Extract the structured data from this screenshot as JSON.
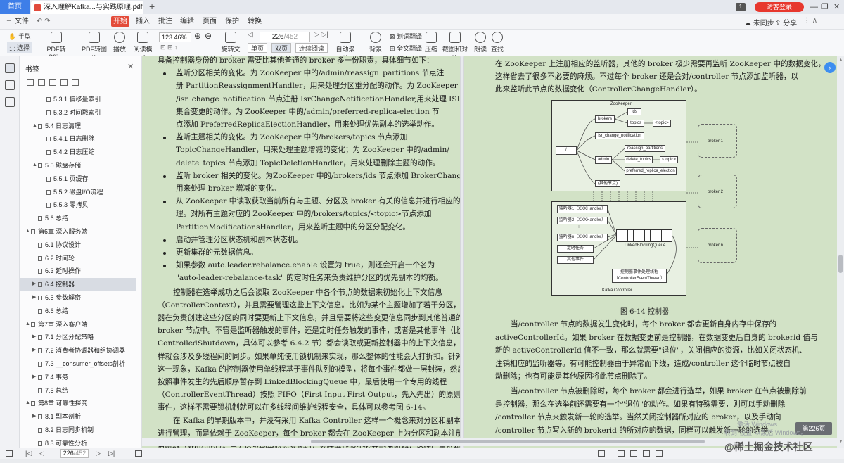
{
  "window": {
    "home_tab": "首页",
    "doc_tab": "深入理解Kafka...与实践原理.pdf",
    "new_tab": "+",
    "login": "访客登录",
    "page_badge": "1"
  },
  "menu": {
    "file": "三 文件",
    "start": "开始",
    "items": [
      "插入",
      "批注",
      "编辑",
      "页面",
      "保护",
      "转换"
    ],
    "cloud": "未同步",
    "share": "分享"
  },
  "toolbar": {
    "hand": "手型",
    "select": "选择",
    "pdf_to_office": "PDF转Office",
    "pdf_to_image": "PDF转图片",
    "play": "播放",
    "read_mode": "阅读模式",
    "zoom": "123.46%",
    "rotate": "旋转文档",
    "page_current": "226",
    "page_total": "/452",
    "single": "单页",
    "double": "双页",
    "continuous": "连续阅读",
    "autoscroll": "自动滚动",
    "background": "背景",
    "word_translate": "划词翻译",
    "full_translate": "全文翻译",
    "compress": "压缩",
    "screenshot": "截图和对比",
    "read_aloud": "朗读",
    "find": "查找"
  },
  "bookmarks": {
    "title": "书签",
    "close": "✕",
    "items": [
      {
        "level": 3,
        "label": "5.3.1 偏移量索引",
        "arrow": ""
      },
      {
        "level": 3,
        "label": "5.3.2 时间戳索引",
        "arrow": ""
      },
      {
        "level": 2,
        "label": "5.4 日志清理",
        "arrow": "▲"
      },
      {
        "level": 3,
        "label": "5.4.1 日志删除",
        "arrow": ""
      },
      {
        "level": 3,
        "label": "5.4.2 日志压缩",
        "arrow": ""
      },
      {
        "level": 2,
        "label": "5.5 磁盘存储",
        "arrow": "▲"
      },
      {
        "level": 3,
        "label": "5.5.1 页缓存",
        "arrow": ""
      },
      {
        "level": 3,
        "label": "5.5.2 磁盘I/O流程",
        "arrow": ""
      },
      {
        "level": 3,
        "label": "5.5.3 零拷贝",
        "arrow": ""
      },
      {
        "level": 2,
        "label": "5.6 总结",
        "arrow": ""
      },
      {
        "level": 1,
        "label": "第6章 深入服务端",
        "arrow": "▲"
      },
      {
        "level": 2,
        "label": "6.1 协议设计",
        "arrow": ""
      },
      {
        "level": 2,
        "label": "6.2 时间轮",
        "arrow": ""
      },
      {
        "level": 2,
        "label": "6.3 延时操作",
        "arrow": ""
      },
      {
        "level": 2,
        "label": "6.4 控制器",
        "arrow": "▶",
        "selected": true
      },
      {
        "level": 2,
        "label": "6.5 参数解密",
        "arrow": "▶"
      },
      {
        "level": 2,
        "label": "6.6 总结",
        "arrow": ""
      },
      {
        "level": 1,
        "label": "第7章 深入客户端",
        "arrow": "▲"
      },
      {
        "level": 2,
        "label": "7.1 分区分配策略",
        "arrow": "▶"
      },
      {
        "level": 2,
        "label": "7.2 消费者协调器和组协调器",
        "arrow": "▶"
      },
      {
        "level": 2,
        "label": "7.3 __consumer_offsets剖析",
        "arrow": ""
      },
      {
        "level": 2,
        "label": "7.4 事务",
        "arrow": "▶"
      },
      {
        "level": 2,
        "label": "7.5 总结",
        "arrow": ""
      },
      {
        "level": 1,
        "label": "第8章 可靠性探究",
        "arrow": "▲"
      },
      {
        "level": 2,
        "label": "8.1 副本剖析",
        "arrow": "▶"
      },
      {
        "level": 2,
        "label": "8.2 日志同步机制",
        "arrow": ""
      },
      {
        "level": 2,
        "label": "8.3 可靠性分析",
        "arrow": ""
      },
      {
        "level": 2,
        "label": "8.4 总结",
        "arrow": ""
      }
    ]
  },
  "left_page": {
    "lines": [
      {
        "t": "具备控制器身份的 broker 需要比其他普通的 broker 多一份职责，具体细节如下：",
        "i": 0
      },
      {
        "t": "监听分区相关的变化。为 ZooKeeper 中的/admin/reassign_partitions 节点注",
        "i": 1,
        "b": true
      },
      {
        "t": "册 PartitionReassignmentHandler，用来处理分区重分配的动作。为 ZooKeeper 中的",
        "i": 2
      },
      {
        "t": "/isr_change_notification 节点注册 IsrChangeNotificetionHandler,用来处理 ISR",
        "i": 2
      },
      {
        "t": "集合变更的动作。为 ZooKeeper 中的/admin/preferred-replica-election 节",
        "i": 2
      },
      {
        "t": "点添加 PreferredReplicaElectionHandler，用来处理优先副本的选举动作。",
        "i": 2
      },
      {
        "t": "监听主题相关的变化。为 ZooKeeper 中的/brokers/topics 节点添加",
        "i": 1,
        "b": true
      },
      {
        "t": "TopicChangeHandler，用来处理主题增减的变化；为 ZooKeeper 中的/admin/",
        "i": 2
      },
      {
        "t": "delete_topics 节点添加 TopicDeletionHandler，用来处理删除主题的动作。",
        "i": 2
      },
      {
        "t": "监听 broker 相关的变化。为ZooKeeper 中的/brokers/ids 节点添加 BrokerChangeHandler,",
        "i": 1,
        "b": true
      },
      {
        "t": "用来处理 broker 增减的变化。",
        "i": 2
      },
      {
        "t": "从 ZooKeeper 中读取获取当前所有与主题、分区及 broker 有关的信息并进行相应的管",
        "i": 1,
        "b": true
      },
      {
        "t": "理。对所有主题对应的 ZooKeeper 中的/brokers/topics/<topic>节点添加",
        "i": 2
      },
      {
        "t": "PartitionModificationsHandler，用来监听主题中的分区分配变化。",
        "i": 2
      },
      {
        "t": "启动并管理分区状态机和副本状态机。",
        "i": 1,
        "b": true
      },
      {
        "t": "更新集群的元数据信息。",
        "i": 1,
        "b": true
      },
      {
        "t": "如果参数 auto.leader.rebalance.enable 设置为 true，则还会开启一个名为",
        "i": 1,
        "b": true
      },
      {
        "t": "\"auto-leader-rebalance-task\" 的定时任务来负责维护分区的优先副本的均衡。",
        "i": 2
      },
      {
        "t": "控制器在选举成功之后会读取 ZooKeeper 中各个节点的数据来初始化上下文信息",
        "i": 3
      },
      {
        "t": "（ControllerContext），并且需要管理这些上下文信息。比如为某个主题增加了若干分区，控制",
        "i": 0
      },
      {
        "t": "器在负责创建这些分区的同时要更新上下文信息，并且需要将这些变更信息同步到其他普通的",
        "i": 0
      },
      {
        "t": "broker 节点中。不管是监听器触发的事件，还是定时任务触发的事件，或者是其他事件（比如",
        "i": 0
      },
      {
        "t": "ControlledShutdown，具体可以参考 6.4.2 节）都会读取或更新控制器中的上下文信息，那么这",
        "i": 0
      },
      {
        "t": "样就会涉及多线程间的同步。如果单纯使用锁机制来实现，那么整体的性能会大打折扣。针对",
        "i": 0
      },
      {
        "t": "这一现象，Kafka 的控制器使用单线程基于事件队列的模型，将每个事件都做一层封装，然后",
        "i": 0
      },
      {
        "t": "按照事件发生的先后顺序暂存到 LinkedBlockingQueue 中，最后使用一个专用的线程",
        "i": 0
      },
      {
        "t": "（ControllerEventThread）按照 FIFO（First Input First Output，先入先出）的原则顺序处理各个",
        "i": 0
      },
      {
        "t": "事件，这样不需要锁机制就可以在多线程间维护线程安全，具体可以参考图 6-14。",
        "i": 0
      },
      {
        "t": "在 Kafka 的早期版本中，并没有采用 Kafka Controller 这样一个概念来对分区和副本的状态",
        "i": 3
      },
      {
        "t": "进行管理，而是依赖于 ZooKeeper，每个 broker 都会在 ZooKeeper 上为分区和副本注册大量的",
        "i": 0
      },
      {
        "t": "监听器（Watcher）。当分区或副本状态变化时，会唤醒很多不必要的监听器，这种严重依赖",
        "i": 0
      }
    ]
  },
  "right_page": {
    "top_lines": [
      "在 ZooKeeper 上注册相应的监听器，其他的 broker 极少需要再监听 ZooKeeper 中的数据变化，",
      "这样省去了很多不必要的麻烦。不过每个 broker 还是会对/controller 节点添加监听器，以",
      "此来监听此节点的数据变化（ControllerChangeHandler）。"
    ],
    "caption": "图 6-14   控制器",
    "bottom_lines": [
      {
        "t": "当/controller 节点的数据发生变化时，每个 broker 都会更新自身内存中保存的",
        "i": 1
      },
      {
        "t": "activeControllerId。如果 broker 在数据变更前是控制器，在数据变更后自身的 brokerid 值与",
        "i": 0
      },
      {
        "t": "新的 activeControllerId 值不一致，那么就需要\"退位\"，关闭相应的资源，比如关闭状态机、",
        "i": 0
      },
      {
        "t": "注销相应的监听器等。有可能控制器由于异常而下线，造成/controller 这个临时节点被自",
        "i": 0
      },
      {
        "t": "动删除；也有可能是其他原因将此节点删除了。",
        "i": 0
      },
      {
        "t": "当/controller 节点被删除时，每个 broker 都会进行选举，如果 broker 在节点被删除前",
        "i": 1
      },
      {
        "t": "是控制器，那么在选举前还需要有一个\"退位\"的动作。如果有特殊需要，则可以手动删除",
        "i": 0
      },
      {
        "t": "/controller 节点来触发新一轮的选举。当然关闭控制器所对应的 broker，以及手动向",
        "i": 0
      },
      {
        "t": "/controller 节点写入新的 brokerid 的所对应的数据，同样可以触发新一轮的选举。",
        "i": 0
      }
    ]
  },
  "diagram": {
    "zookeeper": "ZooKeeper",
    "root": "/",
    "brokers": "brokers",
    "ids": "ids",
    "topics": "topics",
    "topic": "<topic>",
    "isr": "isr_change_notification",
    "admin": "admin",
    "reassign": "reassign_partitions",
    "delete": "delete_topics",
    "topic2": "<topic>",
    "preferred": "preferred_replica_election",
    "other_nodes": "(其他节点)",
    "listener1": "监听器1（XXXHandler）",
    "listener2": "监听器2（XXXHandler）",
    "listenern": "监听器n（XXXHandler）",
    "timer": "定时任务",
    "other_events": "其他事件",
    "queue": "LinkedBlockingQueue",
    "event_thread": "控制器事件处理线程\n（ControllerEventThread）",
    "kafka_controller": "Kafka Controller",
    "broker1": "broker 1",
    "broker2": "broker 2",
    "dots": "......",
    "brokern": "broker n"
  },
  "status": {
    "page_current": "226",
    "page_total": "/452",
    "page_badge": "第226页",
    "watermark1": "激活 Windows",
    "watermark2": "转到\"设置\"以激活 Windows。",
    "watermark3": "@稀土掘金技术社区"
  }
}
